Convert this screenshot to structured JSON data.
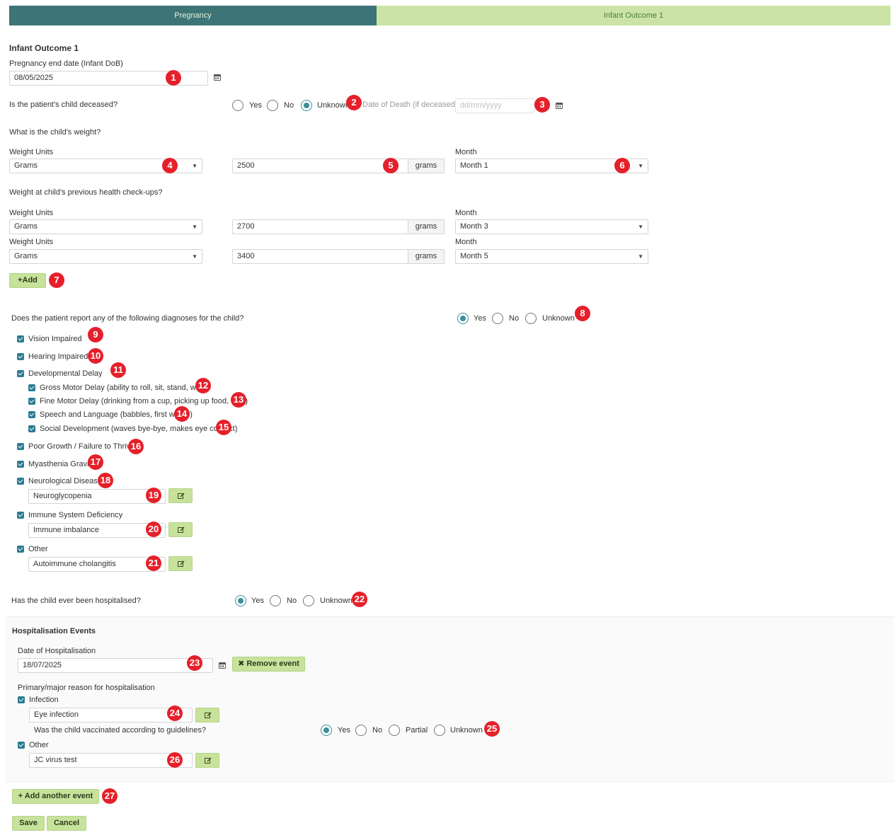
{
  "tabs": [
    {
      "label": "Pregnancy",
      "active": true
    },
    {
      "label": "Infant Outcome 1",
      "active": false
    }
  ],
  "section_title": "Infant Outcome 1",
  "pregnancy_end": {
    "label": "Pregnancy end date (Infant DoB)",
    "value": "08/05/2025"
  },
  "deceased": {
    "question": "Is the patient's child deceased?",
    "options": [
      "Yes",
      "No",
      "Unknown"
    ],
    "selected": "Unknown",
    "date_label": "Date of Death (if deceased)",
    "date_placeholder": "dd/mm/yyyy"
  },
  "weight": {
    "question": "What is the child's weight?",
    "units_label": "Weight Units",
    "month_label": "Month",
    "unit": "Grams",
    "value": "2500",
    "addon": "grams",
    "month": "Month 1"
  },
  "prev_weights": {
    "question": "Weight at child's previous health check-ups?",
    "rows": [
      {
        "units_label": "Weight Units",
        "month_label": "Month",
        "unit": "Grams",
        "value": "2700",
        "addon": "grams",
        "month": "Month 3"
      },
      {
        "units_label": "Weight Units",
        "month_label": "Month",
        "unit": "Grams",
        "value": "3400",
        "addon": "grams",
        "month": "Month 5"
      }
    ],
    "add_label": "+Add"
  },
  "diagnoses": {
    "question": "Does the patient report any of the following diagnoses for the child?",
    "options": [
      "Yes",
      "No",
      "Unknown"
    ],
    "selected": "Yes",
    "items": [
      {
        "label": "Vision Impaired",
        "checked": true
      },
      {
        "label": "Hearing Impaired",
        "checked": true
      },
      {
        "label": "Developmental Delay",
        "checked": true
      },
      {
        "label": "Gross Motor Delay (ability to roll, sit, stand, walk)",
        "checked": true
      },
      {
        "label": "Fine Motor Delay (drinking from a cup, picking up food, toys)",
        "checked": true
      },
      {
        "label": "Speech and Language (babbles, first words)",
        "checked": true
      },
      {
        "label": "Social Development (waves bye-bye, makes eye contact)",
        "checked": true
      },
      {
        "label": "Poor Growth / Failure to Thrive",
        "checked": true
      },
      {
        "label": "Myasthenia Gravis",
        "checked": true
      },
      {
        "label": "Neurological Disease",
        "checked": true
      },
      {
        "label": "Immune System Deficiency",
        "checked": true
      },
      {
        "label": "Other",
        "checked": true
      }
    ],
    "neuro_value": "Neuroglycopenia",
    "immune_value": "Immune imbalance",
    "other_value": "Autoimmune cholangitis"
  },
  "hospitalised": {
    "question": "Has the child ever been hospitalised?",
    "options": [
      "Yes",
      "No",
      "Unknown"
    ],
    "selected": "Yes"
  },
  "events": {
    "title": "Hospitalisation Events",
    "date_label": "Date of Hospitalisation",
    "date_value": "18/07/2025",
    "remove_label": "Remove event",
    "reason_label": "Primary/major reason for hospitalisation",
    "infection_label": "Infection",
    "infection_value": "Eye infection",
    "vaccinated_question": "Was the child vaccinated according to guidelines?",
    "vaccinated_options": [
      "Yes",
      "No",
      "Partial",
      "Unknown"
    ],
    "vaccinated_selected": "Yes",
    "other_label": "Other",
    "other_value": "JC virus test"
  },
  "buttons": {
    "add_event": "+ Add another event",
    "save": "Save",
    "cancel": "Cancel"
  },
  "badges": [
    "1",
    "2",
    "3",
    "4",
    "5",
    "6",
    "7",
    "8",
    "9",
    "10",
    "11",
    "12",
    "13",
    "14",
    "15",
    "16",
    "17",
    "18",
    "19",
    "20",
    "21",
    "22",
    "23",
    "24",
    "25",
    "26",
    "27"
  ]
}
